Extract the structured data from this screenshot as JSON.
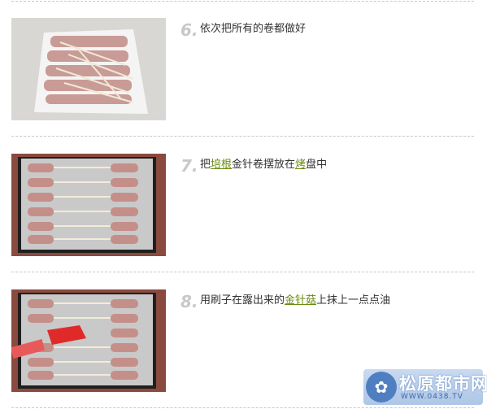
{
  "steps": [
    {
      "number": "6.",
      "parts": [
        {
          "text": "依次把所有的卷都做好",
          "link": false
        }
      ]
    },
    {
      "number": "7.",
      "parts": [
        {
          "text": "把",
          "link": false
        },
        {
          "text": "培根",
          "link": true
        },
        {
          "text": "金针卷摆放在",
          "link": false
        },
        {
          "text": "烤",
          "link": true
        },
        {
          "text": "盘中",
          "link": false
        }
      ]
    },
    {
      "number": "8.",
      "parts": [
        {
          "text": "用刷子在露出来的",
          "link": false
        },
        {
          "text": "金针菇",
          "link": true
        },
        {
          "text": "上抹上一点点油",
          "link": false
        }
      ]
    }
  ],
  "watermark": {
    "name": "松原都市网",
    "url": "WWW.0438.TV",
    "icon": "rabbit-logo-icon"
  },
  "colors": {
    "link": "#6a8a12",
    "step_number": "#c8c8c8"
  }
}
